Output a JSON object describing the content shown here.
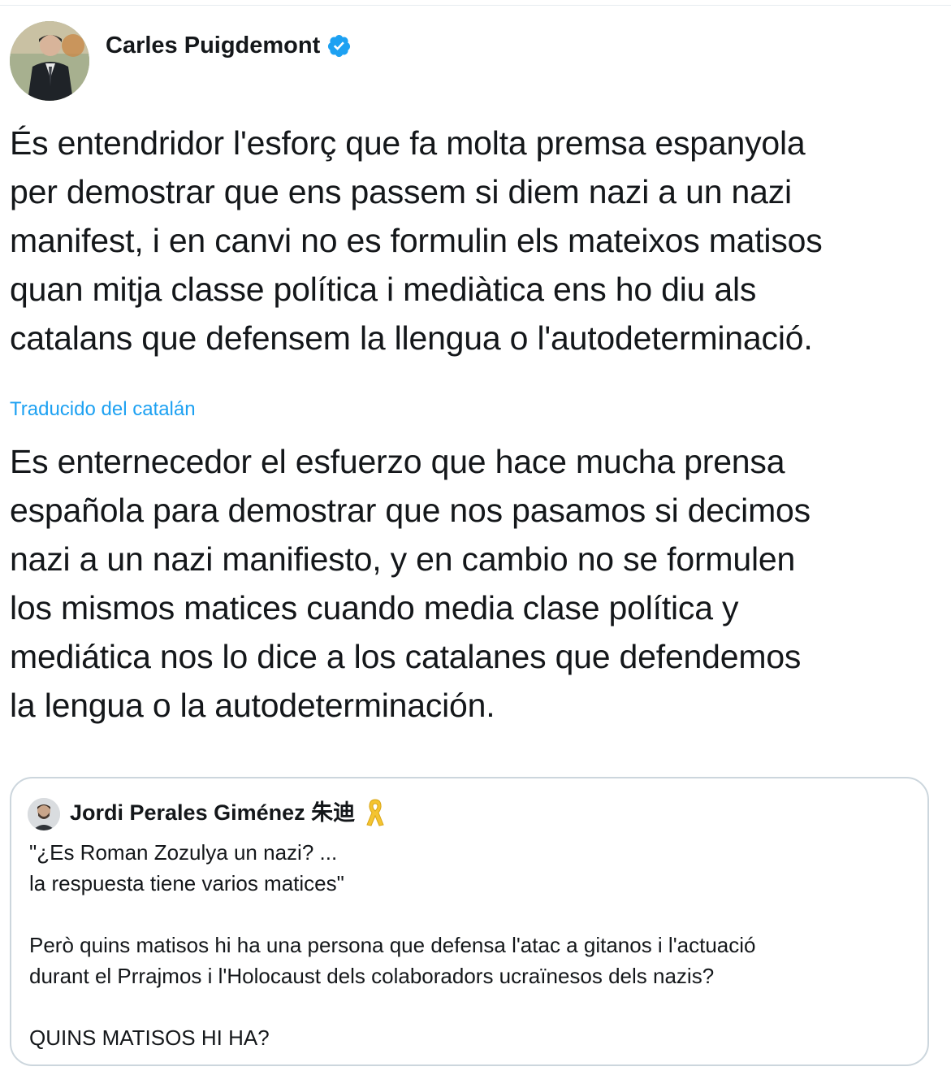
{
  "tweet": {
    "author_name": "Carles Puigdemont",
    "verified_icon": "verified-badge-icon",
    "text": "És entendridor l'esforç que fa molta premsa espanyola\nper demostrar que ens passem si diem nazi a un nazi\nmanifest, i en canvi no es formulin els mateixos matisos\nquan mitja classe política i mediàtica ens ho diu als\ncatalans que defensem la llengua o l'autodeterminació.",
    "translated_label": "Traducido del catalán",
    "translation": "Es enternecedor el esfuerzo que hace mucha prensa\nespañola para demostrar que nos pasamos si decimos\nnazi a un nazi manifiesto, y en cambio no se formulen\nlos mismos matices cuando media clase política y\nmediática nos lo dice a los catalanes que defendemos\nla lengua o la autodeterminación."
  },
  "quoted_tweet": {
    "author_name": "Jordi Perales Giménez 朱迪",
    "ribbon_icon": "yellow-ribbon-icon",
    "text": "\"¿Es Roman Zozulya un nazi? ...\nla respuesta tiene varios matices\"\n\nPerò quins matisos hi ha una persona que defensa l'atac a gitanos i l'actuació\ndurant el Prrajmos i l'Holocaust dels colaboradors ucraïnesos dels nazis?\n\nQUINS MATISOS HI HA?"
  },
  "colors": {
    "link_blue": "#1da1f2",
    "text": "#14171a",
    "card_border": "#ccd6dd",
    "ribbon_yellow": "#f4c430"
  }
}
